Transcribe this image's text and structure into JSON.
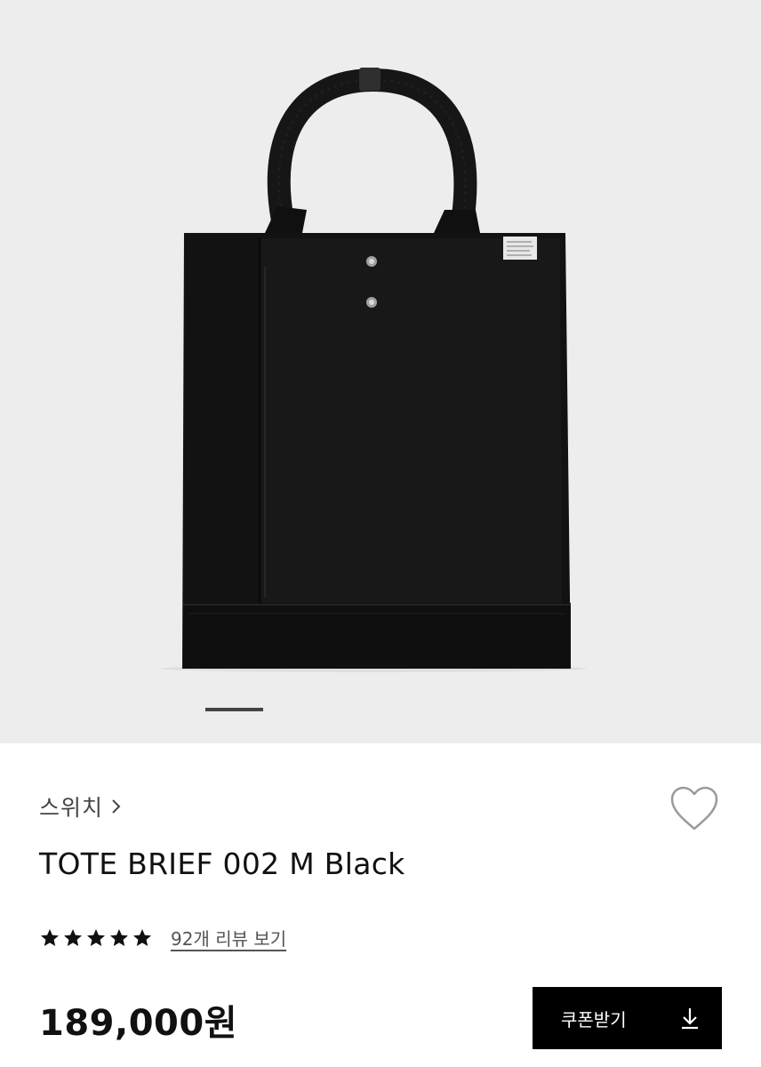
{
  "gallery": {
    "image_alt": "TOTE BRIEF 002 M Black product photo",
    "label_tag_icon": "label-tag",
    "total_slides_indicator": "1"
  },
  "brand": {
    "name": "스위치",
    "chevron_icon": "chevron-right-icon"
  },
  "wishlist": {
    "icon": "heart-outline-icon"
  },
  "product": {
    "title": "TOTE BRIEF 002 M Black"
  },
  "rating": {
    "stars": 5,
    "review_link": "92개 리뷰 보기"
  },
  "price": {
    "display": "189,000원"
  },
  "coupon": {
    "label": "쿠폰받기",
    "icon": "download-icon"
  },
  "colors": {
    "background": "#ffffff",
    "gallery_bg": "#ededed",
    "button_bg": "#000000",
    "button_text": "#ffffff",
    "text": "#111111"
  }
}
